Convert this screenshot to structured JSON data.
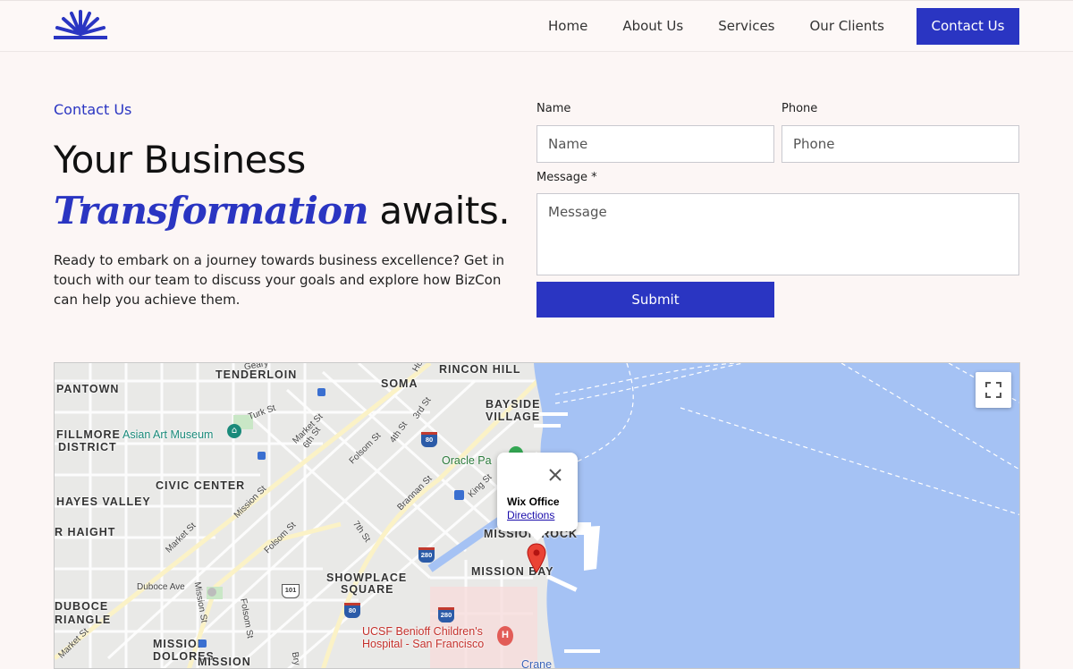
{
  "colors": {
    "accent": "#2a35c2",
    "background": "#fcf6f5",
    "water": "#a5c2f4"
  },
  "header": {
    "logo_icon": "sunburst-logo-icon",
    "nav": [
      {
        "label": "Home"
      },
      {
        "label": "About Us"
      },
      {
        "label": "Services"
      },
      {
        "label": "Our Clients"
      }
    ],
    "cta": "Contact Us"
  },
  "hero": {
    "eyebrow": "Contact Us",
    "headline_line1": "Your Business",
    "headline_accent": "Transformation",
    "headline_rest": "awaits.",
    "intro": "Ready to embark on a journey towards business excellence? Get in touch with our team to discuss your goals and explore how BizCon can help you achieve them."
  },
  "form": {
    "name_label": "Name",
    "name_placeholder": "Name",
    "phone_label": "Phone",
    "phone_placeholder": "Phone",
    "message_label": "Message *",
    "message_placeholder": "Message",
    "submit_label": "Submit"
  },
  "map": {
    "infowindow": {
      "title": "Wix Office",
      "link": "Directions"
    },
    "neighborhoods": [
      "TENDERLOIN",
      "RINCON HILL",
      "SOMA",
      "PANTOWN",
      "BAYSIDE",
      "VILLAGE",
      "FILLMORE",
      "DISTRICT",
      "CIVIC CENTER",
      "HAYES VALLEY",
      "R HAIGHT",
      "SHOWPLACE",
      "SQUARE",
      "MISSION BAY",
      "MISSION ROCK",
      "DUBOCE",
      "RIANGLE",
      "MISSION",
      "DOLORES",
      "MISSION"
    ],
    "pois": {
      "asian_art": "Asian Art Museum",
      "oracle": "Oracle Pa",
      "ucsf_line1": "UCSF Benioff Children's",
      "ucsf_line2": "Hospital - San Francisco",
      "crane": "Crane"
    },
    "streets": [
      "Geary",
      "Turk St",
      "Market St",
      "6th St",
      "3rd St",
      "4th St",
      "Folsom St",
      "Brannan St",
      "King St",
      "Mission St",
      "7th St",
      "Market St",
      "Folsom St",
      "Duboce Ave",
      "Mission St",
      "Folsom St",
      "Market St",
      "Bry",
      "Ho"
    ],
    "shields": [
      "80",
      "280",
      "280",
      "101",
      "80",
      "280"
    ]
  }
}
